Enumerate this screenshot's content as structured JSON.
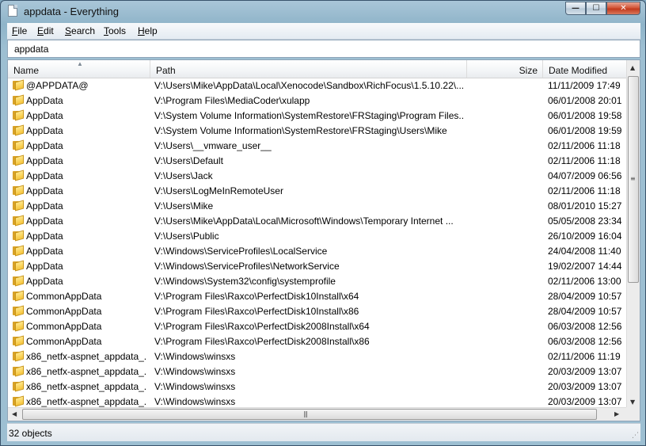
{
  "window": {
    "title": "appdata - Everything"
  },
  "caption": {
    "minimize": "—",
    "maximize": "☐",
    "close": "✕"
  },
  "menu": [
    {
      "accel": "F",
      "rest": "ile"
    },
    {
      "accel": "E",
      "rest": "dit"
    },
    {
      "accel": "S",
      "rest": "earch"
    },
    {
      "accel": "T",
      "rest": "ools"
    },
    {
      "accel": "H",
      "rest": "elp"
    }
  ],
  "search": {
    "value": "appdata"
  },
  "columns": {
    "name": "Name",
    "path": "Path",
    "size": "Size",
    "date": "Date Modified"
  },
  "rows": [
    {
      "name": "@APPDATA@",
      "path": "V:\\Users\\Mike\\AppData\\Local\\Xenocode\\Sandbox\\RichFocus\\1.5.10.22\\...",
      "size": "",
      "date": "11/11/2009 17:49",
      "icon": "folder-icon"
    },
    {
      "name": "AppData",
      "path": "V:\\Program Files\\MediaCoder\\xulapp",
      "size": "",
      "date": "06/01/2008 20:01",
      "icon": "folder-icon"
    },
    {
      "name": "AppData",
      "path": "V:\\System Volume Information\\SystemRestore\\FRStaging\\Program Files...",
      "size": "",
      "date": "06/01/2008 19:58",
      "icon": "folder-icon"
    },
    {
      "name": "AppData",
      "path": "V:\\System Volume Information\\SystemRestore\\FRStaging\\Users\\Mike",
      "size": "",
      "date": "06/01/2008 19:59",
      "icon": "folder-icon"
    },
    {
      "name": "AppData",
      "path": "V:\\Users\\__vmware_user__",
      "size": "",
      "date": "02/11/2006 11:18",
      "icon": "folder-icon"
    },
    {
      "name": "AppData",
      "path": "V:\\Users\\Default",
      "size": "",
      "date": "02/11/2006 11:18",
      "icon": "folder-icon"
    },
    {
      "name": "AppData",
      "path": "V:\\Users\\Jack",
      "size": "",
      "date": "04/07/2009 06:56",
      "icon": "folder-icon"
    },
    {
      "name": "AppData",
      "path": "V:\\Users\\LogMeInRemoteUser",
      "size": "",
      "date": "02/11/2006 11:18",
      "icon": "folder-icon"
    },
    {
      "name": "AppData",
      "path": "V:\\Users\\Mike",
      "size": "",
      "date": "08/01/2010 15:27",
      "icon": "folder-icon"
    },
    {
      "name": "AppData",
      "path": "V:\\Users\\Mike\\AppData\\Local\\Microsoft\\Windows\\Temporary Internet ...",
      "size": "",
      "date": "05/05/2008 23:34",
      "icon": "folder-icon"
    },
    {
      "name": "AppData",
      "path": "V:\\Users\\Public",
      "size": "",
      "date": "26/10/2009 16:04",
      "icon": "folder-icon"
    },
    {
      "name": "AppData",
      "path": "V:\\Windows\\ServiceProfiles\\LocalService",
      "size": "",
      "date": "24/04/2008 11:40",
      "icon": "folder-icon"
    },
    {
      "name": "AppData",
      "path": "V:\\Windows\\ServiceProfiles\\NetworkService",
      "size": "",
      "date": "19/02/2007 14:44",
      "icon": "folder-icon"
    },
    {
      "name": "AppData",
      "path": "V:\\Windows\\System32\\config\\systemprofile",
      "size": "",
      "date": "02/11/2006 13:00",
      "icon": "folder-icon"
    },
    {
      "name": "CommonAppData",
      "path": "V:\\Program Files\\Raxco\\PerfectDisk10Install\\x64",
      "size": "",
      "date": "28/04/2009 10:57",
      "icon": "folder-icon"
    },
    {
      "name": "CommonAppData",
      "path": "V:\\Program Files\\Raxco\\PerfectDisk10Install\\x86",
      "size": "",
      "date": "28/04/2009 10:57",
      "icon": "folder-icon"
    },
    {
      "name": "CommonAppData",
      "path": "V:\\Program Files\\Raxco\\PerfectDisk2008Install\\x64",
      "size": "",
      "date": "06/03/2008 12:56",
      "icon": "folder-icon"
    },
    {
      "name": "CommonAppData",
      "path": "V:\\Program Files\\Raxco\\PerfectDisk2008Install\\x86",
      "size": "",
      "date": "06/03/2008 12:56",
      "icon": "folder-icon"
    },
    {
      "name": "x86_netfx-aspnet_appdata_...",
      "path": "V:\\Windows\\winsxs",
      "size": "",
      "date": "02/11/2006 11:19",
      "icon": "folder-icon"
    },
    {
      "name": "x86_netfx-aspnet_appdata_...",
      "path": "V:\\Windows\\winsxs",
      "size": "",
      "date": "20/03/2009 13:07",
      "icon": "folder-icon"
    },
    {
      "name": "x86_netfx-aspnet_appdata_...",
      "path": "V:\\Windows\\winsxs",
      "size": "",
      "date": "20/03/2009 13:07",
      "icon": "folder-icon"
    },
    {
      "name": "x86_netfx-aspnet_appdata_...",
      "path": "V:\\Windows\\winsxs",
      "size": "",
      "date": "20/03/2009 13:07",
      "icon": "folder-icon"
    }
  ],
  "status": {
    "text": "32 objects"
  }
}
